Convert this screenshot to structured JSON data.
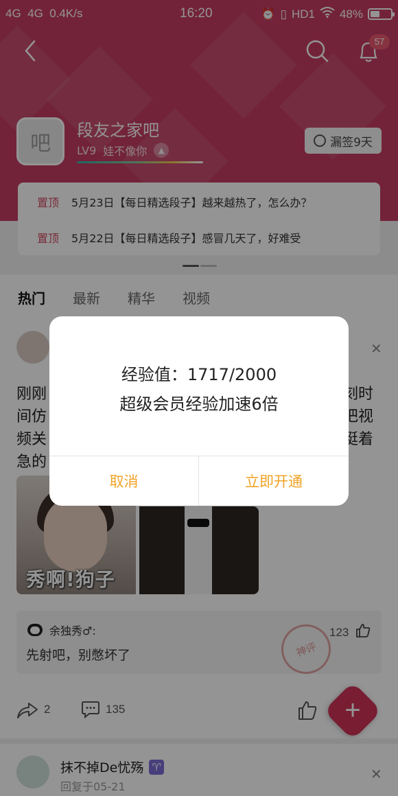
{
  "status_bar": {
    "network": "4G  4G  0.4K/s",
    "time": "16:20",
    "hd": "HD1",
    "battery": "48%",
    "battery_level": 0.48
  },
  "header": {
    "notification_count": "57",
    "forum_avatar_char": "吧",
    "forum_name": "段友之家吧",
    "level": "LV9",
    "level_title": "娃不像你",
    "sign_button": "漏签9天",
    "theme_color": "#c43d64"
  },
  "pinned": [
    {
      "tag": "置顶",
      "title": "5月23日【每日精选段子】越来越热了，怎么办？"
    },
    {
      "tag": "置顶",
      "title": "5月22日【每日精选段子】感冒几天了，好难受"
    }
  ],
  "tabs": [
    "热门",
    "最新",
    "精华",
    "视频"
  ],
  "post": {
    "text_lines": [
      {
        "left": "刚刚",
        "right": "刻时"
      },
      {
        "left": "间仿",
        "right": "把视"
      },
      {
        "left": "频关",
        "right": "挺着"
      },
      {
        "left": "急的",
        "right": ""
      }
    ],
    "image_caption": "秀啊!狗子",
    "comment": {
      "user": "余独秀♂:",
      "text": "先射吧，别憋坏了",
      "likes": "123",
      "stamp": "神评"
    },
    "shares": "2",
    "comments": "135"
  },
  "post2": {
    "user": "抹不掉De忧殇",
    "zodiac": "♈",
    "subtitle": "回复于05-21"
  },
  "dialog": {
    "line1": "经验值：1717/2000",
    "line2": "超级会员经验加速6倍",
    "cancel": "取消",
    "confirm": "立即开通",
    "button_color": "#f0a326"
  }
}
